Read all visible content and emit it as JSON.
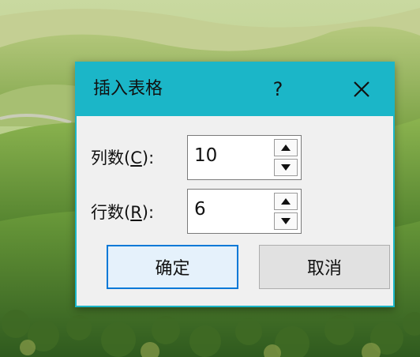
{
  "dialog": {
    "title": "插入表格",
    "help_label": "?",
    "close_icon": "close-icon",
    "accent_color": "#1bb6c8",
    "columns": {
      "label_prefix": "列数(",
      "mnemonic": "C",
      "label_suffix": "):",
      "value": "10"
    },
    "rows": {
      "label_prefix": "行数(",
      "mnemonic": "R",
      "label_suffix": "):",
      "value": "6"
    },
    "ok_label": "确定",
    "cancel_label": "取消"
  }
}
